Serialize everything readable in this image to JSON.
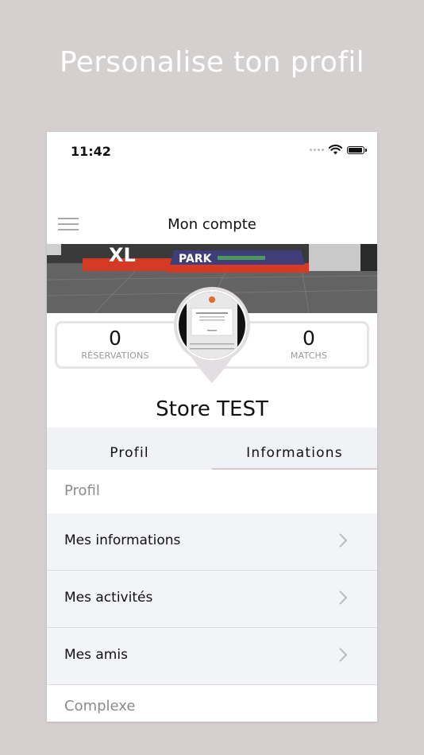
{
  "promo": {
    "headline": "Personalise ton profil"
  },
  "status_bar": {
    "time": "11:42"
  },
  "nav": {
    "title": "Mon compte",
    "menu_icon": "hamburger-menu-icon"
  },
  "cover": {
    "sign_text": "PARK",
    "sign_letters": "XL"
  },
  "stats": {
    "reservations": {
      "value": "0",
      "label": "RÉSERVATIONS"
    },
    "matchs": {
      "value": "0",
      "label": "MATCHS"
    }
  },
  "profile": {
    "name": "Store TEST"
  },
  "tabs": [
    {
      "label": "Profil",
      "active": false
    },
    {
      "label": "Informations",
      "active": true
    }
  ],
  "sections": {
    "profil": {
      "title": "Profil",
      "items": [
        {
          "label": "Mes informations"
        },
        {
          "label": "Mes activités"
        },
        {
          "label": "Mes amis"
        }
      ]
    },
    "complexe": {
      "title": "Complexe"
    }
  },
  "colors": {
    "background": "#d6cfd0",
    "accent_border": "#e6e3e6",
    "tab_underline": "#d8c9cd",
    "list_bg": "#f3f4f7"
  }
}
